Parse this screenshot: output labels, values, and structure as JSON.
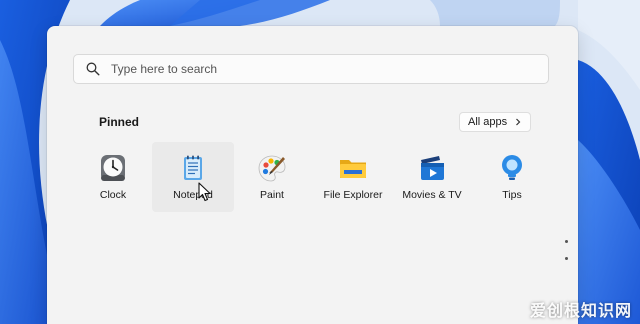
{
  "search": {
    "placeholder": "Type here to search"
  },
  "pinned": {
    "title": "Pinned",
    "all_apps_label": "All apps"
  },
  "apps": [
    {
      "label": "Clock",
      "icon": "clock-icon"
    },
    {
      "label": "Notepad",
      "icon": "notepad-icon"
    },
    {
      "label": "Paint",
      "icon": "paint-icon"
    },
    {
      "label": "File Explorer",
      "icon": "folder-icon"
    },
    {
      "label": "Movies & TV",
      "icon": "movies-tv-icon"
    },
    {
      "label": "Tips",
      "icon": "tips-icon"
    }
  ],
  "watermark": "爱创根知识网",
  "colors": {
    "accent": "#0a63d8",
    "menu_bg": "#f3f3f3"
  }
}
